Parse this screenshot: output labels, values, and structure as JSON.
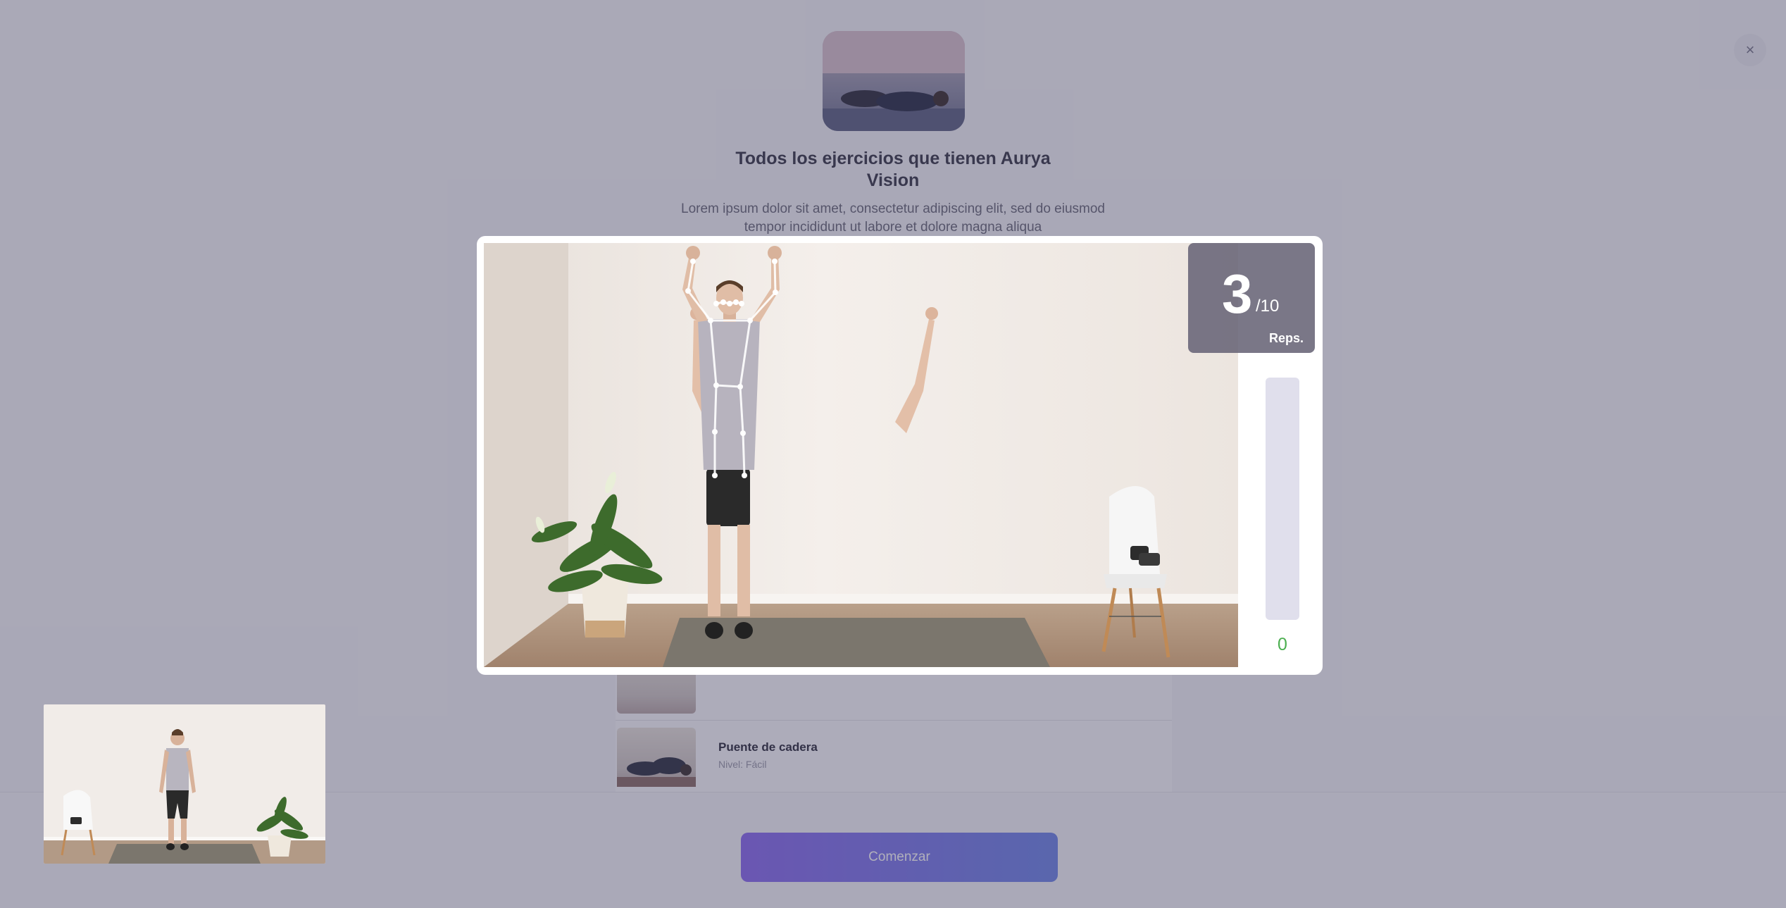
{
  "background": {
    "title": "Todos los ejercicios que tienen Aurya Vision",
    "description": "Lorem ipsum dolor sit amet, consectetur adipiscing elit, sed do eiusmod tempor incididunt ut labore et dolore magna aliqua",
    "exercises": [
      {
        "name": "Puente de cadera",
        "subtitle": "Nivel: Fácil"
      }
    ],
    "start_label": "Comenzar",
    "close_label": "×"
  },
  "counter": {
    "current": "3",
    "total": "/10",
    "label": "Reps."
  },
  "progress": {
    "value": "0",
    "fill_fraction": 0,
    "color": "#4caf50"
  },
  "colors": {
    "overlay": "#3a3856",
    "track": "#e0dfec",
    "accent_gradient_start": "#8b6cf0",
    "accent_gradient_end": "#6f86e8"
  }
}
